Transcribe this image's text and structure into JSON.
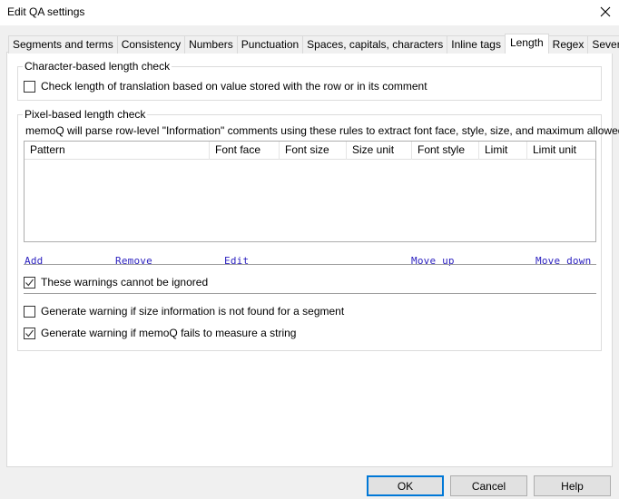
{
  "window": {
    "title": "Edit QA settings",
    "close_icon": "close-x-icon"
  },
  "tabs": [
    {
      "label": "Segments and terms",
      "active": false
    },
    {
      "label": "Consistency",
      "active": false
    },
    {
      "label": "Numbers",
      "active": false
    },
    {
      "label": "Punctuation",
      "active": false
    },
    {
      "label": "Spaces, capitals, characters",
      "active": false
    },
    {
      "label": "Inline tags",
      "active": false
    },
    {
      "label": "Length",
      "active": true
    },
    {
      "label": "Regex",
      "active": false
    },
    {
      "label": "Severity",
      "active": false
    }
  ],
  "character_check": {
    "group_label": "Character-based length check",
    "checkbox_label": "Check length of translation based on value stored with the row or in its comment",
    "checked": false
  },
  "pixel_check": {
    "group_label": "Pixel-based length check",
    "description": "memoQ will parse row-level \"Information\" comments using these rules to extract font face, style, size, and maximum allowed width.",
    "columns": [
      "Pattern",
      "Font face",
      "Font size",
      "Size unit",
      "Font style",
      "Limit",
      "Limit unit"
    ],
    "rows": [],
    "actions": {
      "add": "Add",
      "remove": "Remove",
      "edit": "Edit",
      "move_up": "Move up",
      "move_down": "Move down"
    },
    "cannot_ignore": {
      "label": "These warnings cannot be ignored",
      "checked": true
    },
    "warn_size_missing": {
      "label": "Generate warning if size information is not found for a segment",
      "checked": false
    },
    "warn_measure_fail": {
      "label": "Generate warning if memoQ fails to measure a string",
      "checked": true
    }
  },
  "buttons": {
    "ok": "OK",
    "cancel": "Cancel",
    "help": "Help"
  },
  "colors": {
    "link": "#2a1fbf",
    "default_button_border": "#0078d7"
  }
}
